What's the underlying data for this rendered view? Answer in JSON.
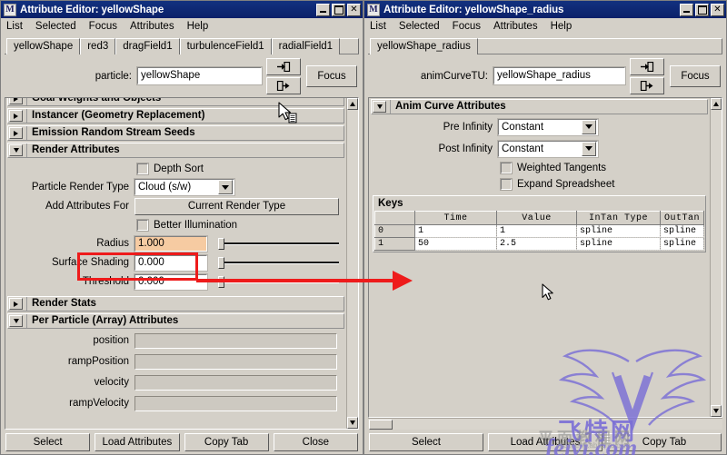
{
  "left_window": {
    "title": "Attribute Editor: yellowShape",
    "title_icon": "maya-m-icon",
    "window_buttons": [
      "minimize",
      "maximize",
      "close"
    ],
    "menu": [
      "List",
      "Selected",
      "Focus",
      "Attributes",
      "Help"
    ],
    "tabs": [
      {
        "label": "yellowShape",
        "selected": true
      },
      {
        "label": "red3",
        "selected": false
      },
      {
        "label": "dragField1",
        "selected": false
      },
      {
        "label": "turbulenceField1",
        "selected": false
      },
      {
        "label": "radialField1",
        "selected": false
      }
    ],
    "node": {
      "label": "particle:",
      "value": "yellowShape",
      "placeholder": "",
      "focus_button": "Focus"
    },
    "sections": [
      {
        "title": "Goal Weights and Objects",
        "expanded": false
      },
      {
        "title": "Instancer (Geometry Replacement)",
        "expanded": false
      },
      {
        "title": "Emission Random Stream Seeds",
        "expanded": false
      },
      {
        "title": "Render Attributes",
        "expanded": true
      },
      {
        "title": "Render Stats",
        "expanded": false
      },
      {
        "title": "Per Particle (Array) Attributes",
        "expanded": true
      }
    ],
    "render_attributes": {
      "depth_sort": {
        "label": "Depth Sort",
        "checked": false
      },
      "particle_render_type": {
        "label": "Particle Render Type",
        "value": "Cloud (s/w)"
      },
      "add_attributes_for": {
        "label": "Add Attributes For",
        "button": "Current Render Type"
      },
      "better_illumination": {
        "label": "Better Illumination",
        "checked": false
      },
      "radius": {
        "label": "Radius",
        "value": "1.000",
        "highlighted": true
      },
      "surface_shading": {
        "label": "Surface Shading",
        "value": "0.000"
      },
      "threshold": {
        "label": "Threshold",
        "value": "0.000"
      }
    },
    "per_particle_attributes": [
      {
        "label": "position",
        "value": ""
      },
      {
        "label": "rampPosition",
        "value": ""
      },
      {
        "label": "velocity",
        "value": ""
      },
      {
        "label": "rampVelocity",
        "value": ""
      }
    ],
    "bottom_buttons": [
      "Select",
      "Load Attributes",
      "Copy Tab",
      "Close"
    ]
  },
  "right_window": {
    "title": "Attribute Editor: yellowShape_radius",
    "title_icon": "maya-m-icon",
    "window_buttons": [
      "minimize",
      "maximize",
      "close"
    ],
    "menu": [
      "List",
      "Selected",
      "Focus",
      "Attributes",
      "Help"
    ],
    "tabs": [
      {
        "label": "yellowShape_radius",
        "selected": true
      }
    ],
    "node": {
      "label": "animCurveTU:",
      "value": "yellowShape_radius",
      "placeholder": "",
      "focus_button": "Focus"
    },
    "sections": [
      {
        "title": "Anim Curve Attributes",
        "expanded": true
      }
    ],
    "anim_curve_attributes": {
      "pre_infinity": {
        "label": "Pre Infinity",
        "value": "Constant"
      },
      "post_infinity": {
        "label": "Post Infinity",
        "value": "Constant"
      },
      "weighted_tangents": {
        "label": "Weighted Tangents",
        "checked": false
      },
      "expand_spreadsheet": {
        "label": "Expand Spreadsheet",
        "checked": false
      }
    },
    "keys": {
      "title": "Keys",
      "columns": [
        "",
        "Time",
        "Value",
        "InTan Type",
        "OutTan"
      ],
      "rows": [
        [
          "0",
          "1",
          "1",
          "spline",
          "spline"
        ],
        [
          "1",
          "50",
          "2.5",
          "spline",
          "spline"
        ]
      ]
    },
    "bottom_buttons": [
      "Select",
      "Load Attributes",
      "Copy Tab"
    ]
  },
  "annotations": {
    "highlight_box_target": "Radius",
    "arrow_color": "#ee1b1b",
    "highlight_field_color": "#f6cba2"
  },
  "watermark": {
    "logo": "winged-v-logo",
    "brand_cn": "飞特网",
    "brand_cn_secondary": "平面教程网",
    "url": "feivi.com",
    "subtext": "jiaocheng.abaziku.com",
    "color": "#7b6fd6"
  }
}
